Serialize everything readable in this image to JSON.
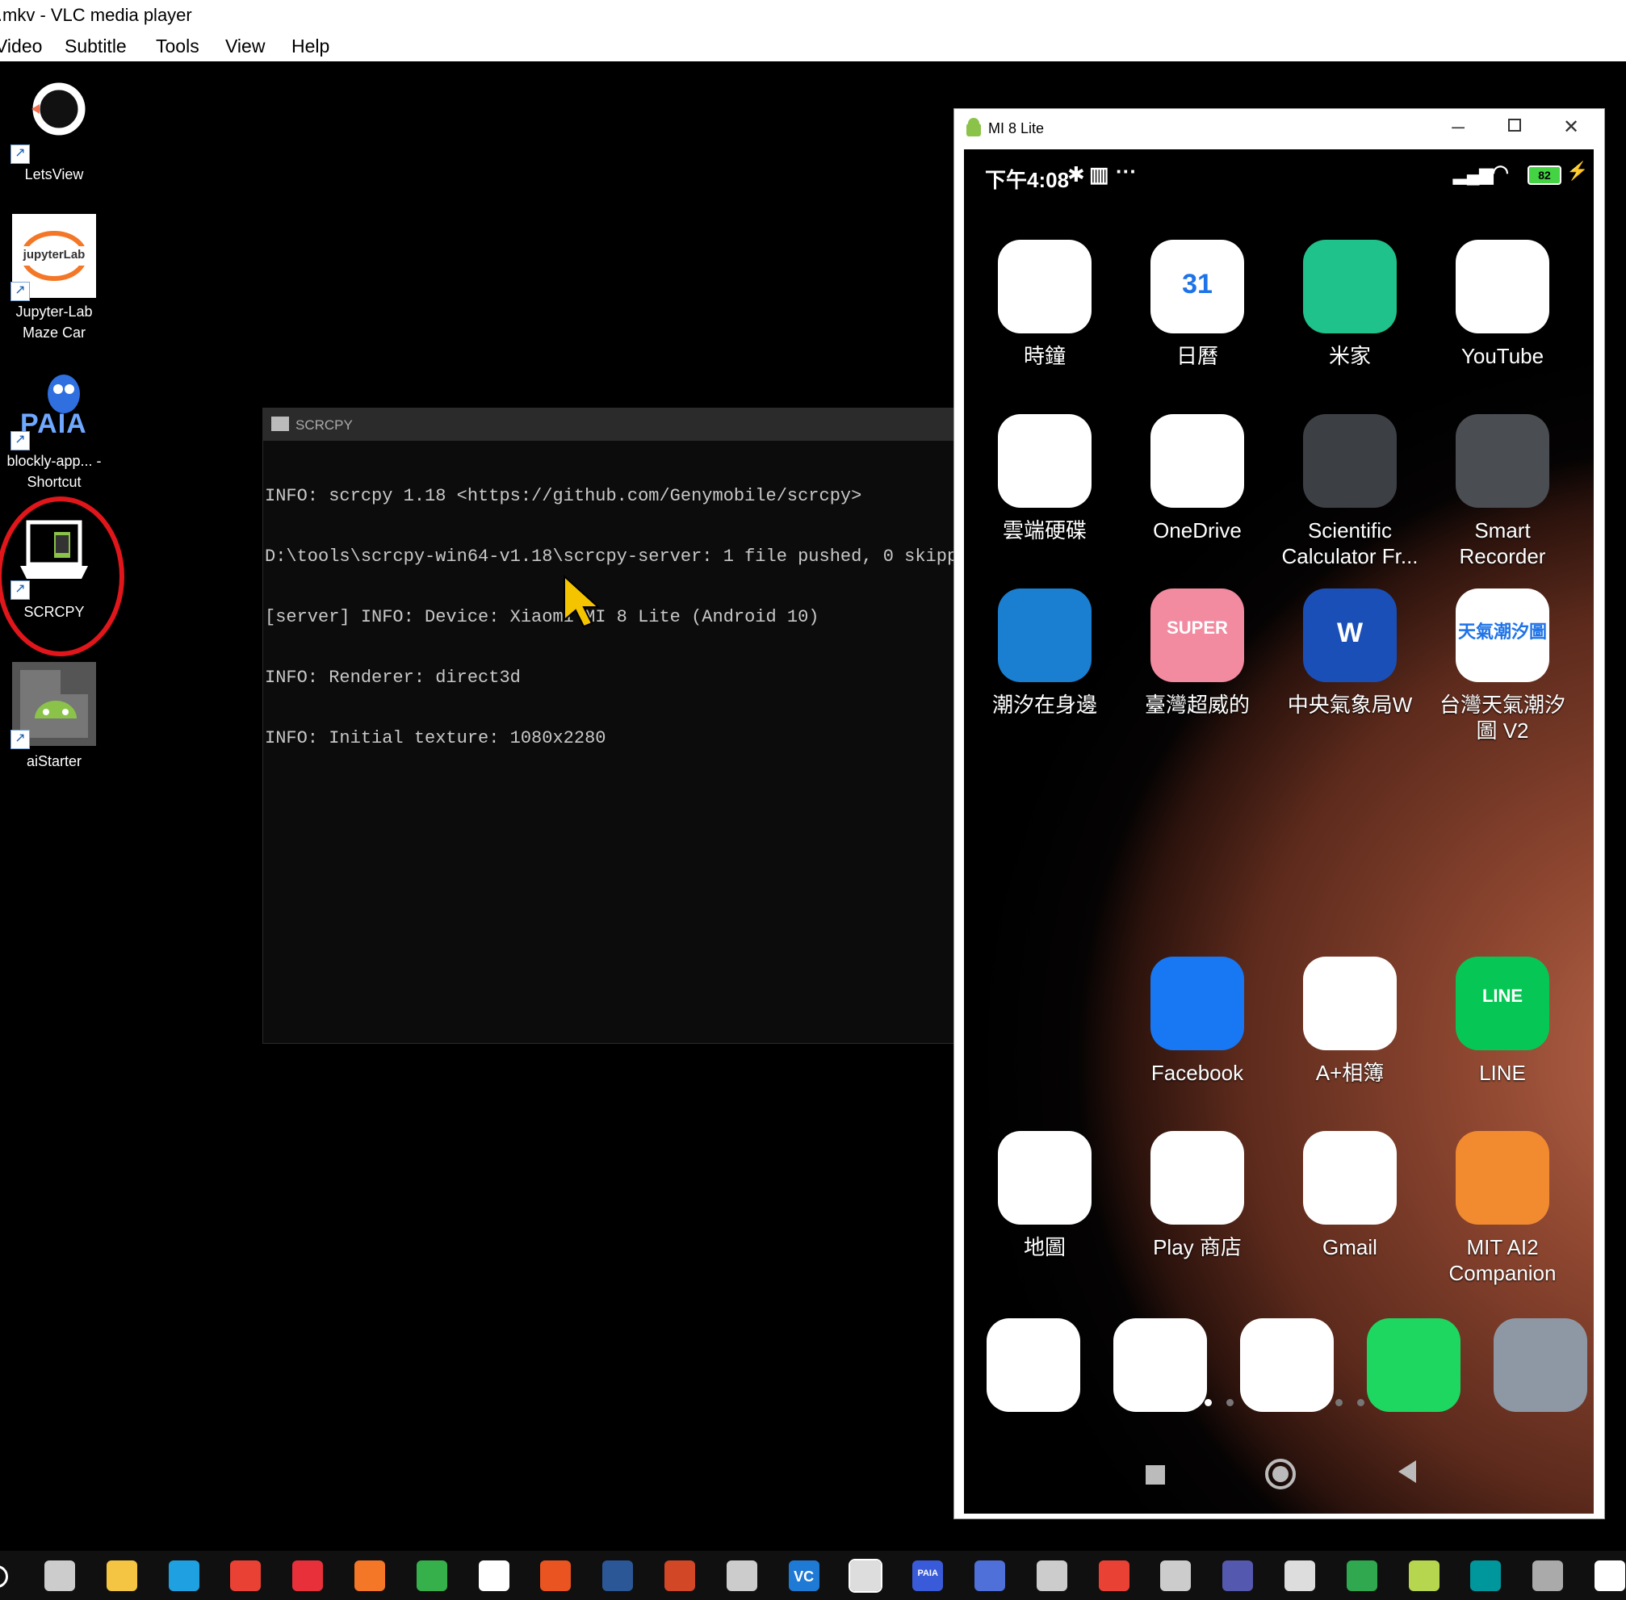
{
  "vlc": {
    "title": "l.mkv - VLC media player",
    "menu": [
      "Video",
      "Subtitle",
      "Tools",
      "View",
      "Help"
    ]
  },
  "desktop_icons": [
    {
      "label": "LetsView",
      "icon": "letsview-icon"
    },
    {
      "label": "Jupyter-Lab Maze Car",
      "icon": "jupyterlab-icon",
      "logo_text": "jupyterLab"
    },
    {
      "label": "blockly-app... - Shortcut",
      "icon": "paia-icon",
      "logo_text": "PAIA"
    },
    {
      "label": "SCRCPY",
      "icon": "scrcpy-icon"
    },
    {
      "label": "aiStarter",
      "icon": "aistarter-icon"
    }
  ],
  "highlight_color": "#e0161b",
  "console": {
    "title": "SCRCPY",
    "lines": [
      "INFO: scrcpy 1.18 <https://github.com/Genymobile/scrcpy>",
      "D:\\tools\\scrcpy-win64-v1.18\\scrcpy-server: 1 file pushed, 0 skipped.",
      "[server] INFO: Device: Xiaomi MI 8 Lite (Android 10)",
      "INFO: Renderer: direct3d",
      "INFO: Initial texture: 1080x2280"
    ]
  },
  "phone_window": {
    "title": "MI 8 Lite",
    "controls": [
      "minimize",
      "maximize",
      "close"
    ],
    "status": {
      "time": "下午4:08",
      "battery": "82"
    },
    "apps": [
      {
        "name": "時鐘",
        "icon": "clock-icon",
        "color": "#ffffff"
      },
      {
        "name": "日曆",
        "icon": "calendar-icon",
        "color": "#ffffff",
        "badge": "31"
      },
      {
        "name": "米家",
        "icon": "mijia-icon",
        "color": "#1fc28b"
      },
      {
        "name": "YouTube",
        "icon": "youtube-icon",
        "color": "#ffffff"
      },
      {
        "name": "雲端硬碟",
        "icon": "google-drive-icon",
        "color": "#ffffff"
      },
      {
        "name": "OneDrive",
        "icon": "onedrive-icon",
        "color": "#ffffff"
      },
      {
        "name": "Scientific Calculator Fr...",
        "icon": "calculator-icon",
        "color": "#3c3f44"
      },
      {
        "name": "Smart Recorder",
        "icon": "recorder-icon",
        "color": "#4a4d52"
      },
      {
        "name": "潮汐在身邊",
        "icon": "tide-icon",
        "color": "#1a7fd1"
      },
      {
        "name": "臺灣超威的",
        "icon": "super-weather-icon",
        "color": "#f28aa0",
        "badge": "SUPER"
      },
      {
        "name": "中央氣象局W",
        "icon": "cwb-weather-icon",
        "color": "#1b4fb8",
        "badge": "W"
      },
      {
        "name": "台灣天氣潮汐圖 V2",
        "icon": "tw-weather-tide-icon",
        "color": "#ffffff",
        "badge": "天氣潮汐圖"
      },
      {
        "name": "Facebook",
        "icon": "facebook-icon",
        "color": "#1877f2"
      },
      {
        "name": "A+相簿",
        "icon": "gallery-icon",
        "color": "#ffffff"
      },
      {
        "name": "LINE",
        "icon": "line-icon",
        "color": "#06c755",
        "badge": "LINE"
      },
      {
        "name": "地圖",
        "icon": "maps-icon",
        "color": "#ffffff"
      },
      {
        "name": "Play 商店",
        "icon": "play-store-icon",
        "color": "#ffffff"
      },
      {
        "name": "Gmail",
        "icon": "gmail-icon",
        "color": "#ffffff"
      },
      {
        "name": "MIT AI2 Companion",
        "icon": "ai2-companion-icon",
        "color": "#f28b30"
      }
    ],
    "page_dots": 8,
    "dock": [
      {
        "icon": "messenger-icon",
        "color": "#ffffff"
      },
      {
        "icon": "camera-icon",
        "color": "#ffffff"
      },
      {
        "icon": "chrome-icon",
        "color": "#ffffff"
      },
      {
        "icon": "phone-icon",
        "color": "#1ed760"
      },
      {
        "icon": "settings-icon",
        "color": "#8e98a4"
      }
    ],
    "nav": [
      "recents-button",
      "home-button",
      "back-button"
    ]
  },
  "taskbar": [
    {
      "icon": "task-view-icon",
      "color": "#cccccc"
    },
    {
      "icon": "file-explorer-icon",
      "color": "#f4c542"
    },
    {
      "icon": "edge-icon",
      "color": "#1fa0e0"
    },
    {
      "icon": "chrome-icon",
      "color": "#e94235"
    },
    {
      "icon": "xmind-icon",
      "color": "#e8303a"
    },
    {
      "icon": "jupyter-icon",
      "color": "#f37726"
    },
    {
      "icon": "sync-icon",
      "color": "#36b04a"
    },
    {
      "icon": "arduino-app-icon",
      "color": "#ffffff"
    },
    {
      "icon": "ubuntu-icon",
      "color": "#e95420"
    },
    {
      "icon": "word-icon",
      "color": "#2b5797"
    },
    {
      "icon": "powerpoint-icon",
      "color": "#d24726"
    },
    {
      "icon": "inkscape-icon",
      "color": "#cccccc"
    },
    {
      "icon": "vc-icon",
      "color": "#1f7ad6",
      "text": "VC"
    },
    {
      "icon": "scrcpy-icon",
      "color": "#dddddd"
    },
    {
      "icon": "paia-icon",
      "color": "#3a5bd9",
      "text": "PAIA"
    },
    {
      "icon": "tetris-icon",
      "color": "#4f6fd9"
    },
    {
      "icon": "screen-tool-icon",
      "color": "#cccccc"
    },
    {
      "icon": "snipping-icon",
      "color": "#e94235"
    },
    {
      "icon": "remote-icon",
      "color": "#cccccc"
    },
    {
      "icon": "teams-icon",
      "color": "#5558af"
    },
    {
      "icon": "obs-icon",
      "color": "#dddddd"
    },
    {
      "icon": "camera-app-icon",
      "color": "#2fa84f"
    },
    {
      "icon": "notepad-icon",
      "color": "#b7d64f"
    },
    {
      "icon": "arduino-icon",
      "color": "#00979c"
    },
    {
      "icon": "usb-icon",
      "color": "#aaaaaa"
    },
    {
      "icon": "intellij-icon",
      "color": "#ffffff"
    }
  ]
}
